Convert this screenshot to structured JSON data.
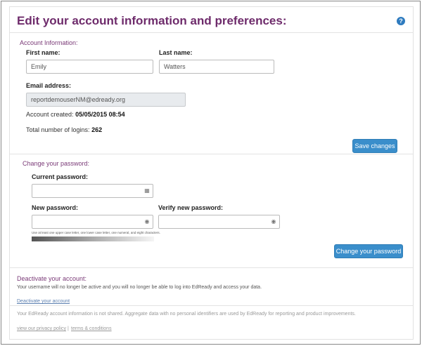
{
  "header": {
    "title": "Edit your account information and preferences:",
    "help_icon": "?"
  },
  "account_info": {
    "section_title": "Account Information:",
    "first_name_label": "First name:",
    "first_name_value": "Emily",
    "last_name_label": "Last name:",
    "last_name_value": "Watters",
    "email_label": "Email address:",
    "email_value": "reportdemouserNM@edready.org",
    "created_label": "Account created:",
    "created_value": "05/05/2015 08:54",
    "logins_label": "Total number of logins:",
    "logins_value": "262",
    "save_label": "Save changes"
  },
  "password": {
    "section_title": "Change your password:",
    "current_label": "Current password:",
    "current_value": "",
    "new_label": "New password:",
    "new_value": "",
    "verify_label": "Verify new password:",
    "verify_value": "",
    "hint": "Use at least one upper case letter, one lower case letter, one numeral, and eight characters.",
    "change_label": "Change your password"
  },
  "deactivate": {
    "section_title": "Deactivate your account:",
    "description": "Your username will no longer be active and you will no longer be able to log into EdReady and access your data.",
    "link_label": "Deactivate your account"
  },
  "footer": {
    "privacy_note": "Your EdReady account information is not shared. Aggregate data with no personal identifiers are used by EdReady for reporting and product improvements.",
    "privacy_link": "view our privacy policy",
    "separator": "|",
    "terms_link": "terms & conditions"
  },
  "icons": {
    "key_icon": "key-icon",
    "eye_icon": "eye-icon"
  }
}
